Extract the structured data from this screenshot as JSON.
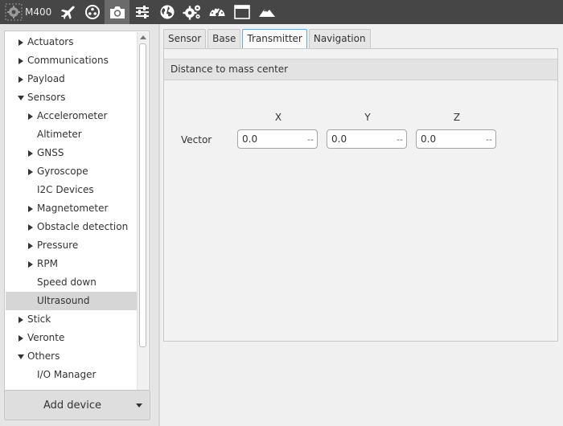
{
  "toolbar": {
    "device_label": "M400",
    "icons": [
      "gear-icon",
      "airplane-icon",
      "radio-icon",
      "camera-icon",
      "sliders-icon",
      "globe-icon",
      "gears-icon",
      "gauge-icon",
      "window-icon",
      "mountain-icon"
    ],
    "active_icon": "camera-icon"
  },
  "tree": {
    "items": [
      {
        "label": "Actuators",
        "level": 0,
        "arrow": "right"
      },
      {
        "label": "Communications",
        "level": 0,
        "arrow": "right"
      },
      {
        "label": "Payload",
        "level": 0,
        "arrow": "right"
      },
      {
        "label": "Sensors",
        "level": 0,
        "arrow": "down"
      },
      {
        "label": "Accelerometer",
        "level": 1,
        "arrow": "right"
      },
      {
        "label": "Altimeter",
        "level": 1,
        "arrow": ""
      },
      {
        "label": "GNSS",
        "level": 1,
        "arrow": "right"
      },
      {
        "label": "Gyroscope",
        "level": 1,
        "arrow": "right"
      },
      {
        "label": "I2C Devices",
        "level": 1,
        "arrow": ""
      },
      {
        "label": "Magnetometer",
        "level": 1,
        "arrow": "right"
      },
      {
        "label": "Obstacle detection",
        "level": 1,
        "arrow": "right"
      },
      {
        "label": "Pressure",
        "level": 1,
        "arrow": "right"
      },
      {
        "label": "RPM",
        "level": 1,
        "arrow": "right"
      },
      {
        "label": "Speed down",
        "level": 1,
        "arrow": ""
      },
      {
        "label": "Ultrasound",
        "level": 1,
        "arrow": "",
        "selected": true
      },
      {
        "label": "Stick",
        "level": 0,
        "arrow": "right"
      },
      {
        "label": "Veronte",
        "level": 0,
        "arrow": "right"
      },
      {
        "label": "Others",
        "level": 0,
        "arrow": "down"
      },
      {
        "label": "I/O Manager",
        "level": 1,
        "arrow": ""
      }
    ]
  },
  "add_device": {
    "label": "Add device"
  },
  "tabs": [
    {
      "label": "Sensor",
      "active": false
    },
    {
      "label": "Base",
      "active": false
    },
    {
      "label": "Transmitter",
      "active": true
    },
    {
      "label": "Navigation",
      "active": false
    }
  ],
  "panel": {
    "header": "Distance to mass center",
    "row_label": "Vector",
    "columns": [
      "X",
      "Y",
      "Z"
    ],
    "fields": [
      {
        "value": "0.0",
        "unit": "--"
      },
      {
        "value": "0.0",
        "unit": "--"
      },
      {
        "value": "0.0",
        "unit": "--"
      }
    ]
  },
  "colors": {
    "toolbar_bg": "#464646",
    "active_tab_border": "#6aa6d8",
    "selected_row": "#d6d6d6"
  }
}
